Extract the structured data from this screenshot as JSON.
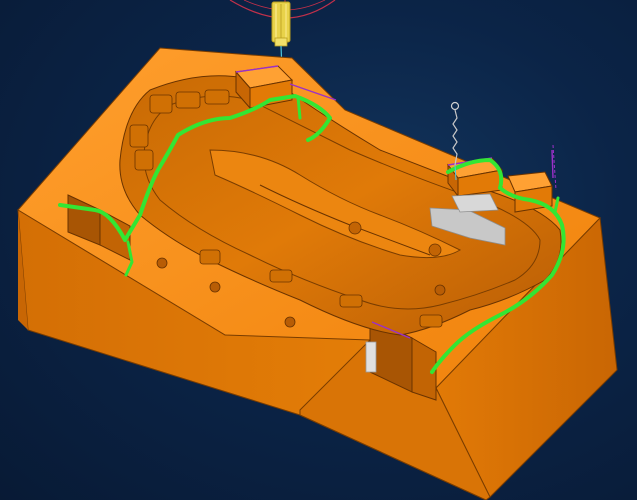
{
  "viewport": {
    "background": "#0b2447"
  },
  "model": {
    "body_color": "#f08a12",
    "shade_dark": "#b85d05",
    "shade_mid": "#d97606",
    "shade_light": "#ffa133"
  },
  "toolpath": {
    "color": "#33e633",
    "edge_color": "#9b30c8"
  },
  "tools": {
    "cutter_color": "#e8d24a",
    "holder_color": "#c0304a",
    "probe_color": "#c7c7c7"
  }
}
